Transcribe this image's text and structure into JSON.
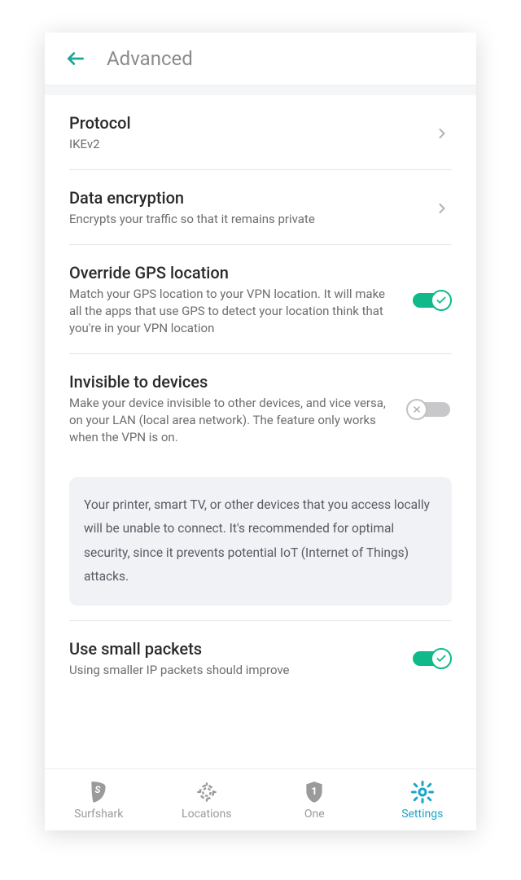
{
  "header": {
    "title": "Advanced"
  },
  "settings": {
    "protocol": {
      "title": "Protocol",
      "value": "IKEv2"
    },
    "encryption": {
      "title": "Data encryption",
      "desc": "Encrypts your traffic so that it remains private"
    },
    "gps": {
      "title": "Override GPS location",
      "desc": "Match your GPS location to your VPN location. It will make all the apps that use GPS to detect your location think that you're in your VPN location"
    },
    "invisible": {
      "title": "Invisible to devices",
      "desc": "Make your device invisible to other devices, and vice versa, on your LAN (local area network). The feature only works when the VPN is on.",
      "note": "Your printer, smart TV, or other devices that you access locally will be unable to connect. It's recommended for optimal security, since it prevents potential IoT (Internet of Things) attacks."
    },
    "packets": {
      "title": "Use small packets",
      "desc": "Using smaller IP packets should improve"
    }
  },
  "nav": {
    "surfshark": "Surfshark",
    "locations": "Locations",
    "one": "One",
    "settings": "Settings"
  }
}
